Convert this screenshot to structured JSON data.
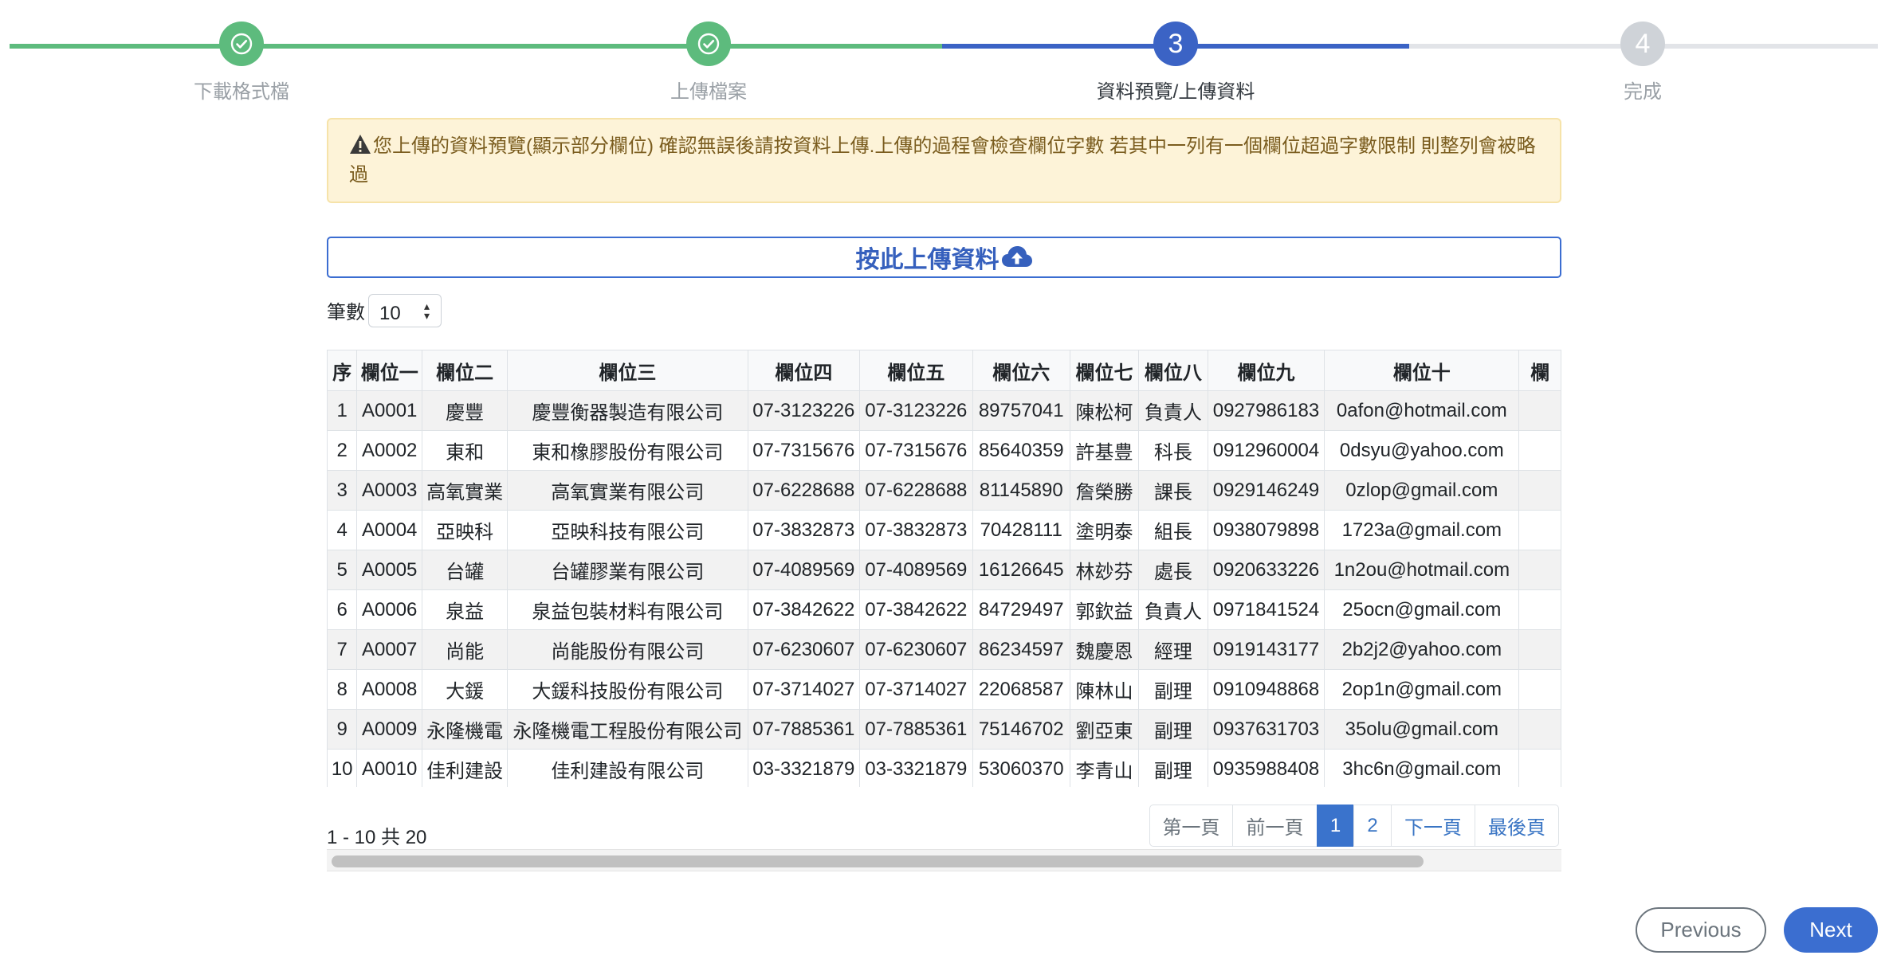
{
  "stepper": {
    "steps": [
      {
        "label": "下載格式檔",
        "state": "done"
      },
      {
        "label": "上傳檔案",
        "state": "done"
      },
      {
        "label": "資料預覽/上傳資料",
        "state": "active",
        "number": "3"
      },
      {
        "label": "完成",
        "state": "pending",
        "number": "4"
      }
    ],
    "colors": {
      "done": "#5dbb7d",
      "active": "#3b63c5",
      "pending": "#cfd3d8"
    }
  },
  "alert": {
    "icon": "warning-triangle-icon",
    "text": "您上傳的資料預覽(顯示部分欄位) 確認無誤後請按資料上傳.上傳的過程會檢查欄位字數 若其中一列有一個欄位超過字數限制 則整列會被略過"
  },
  "upload": {
    "label": "按此上傳資料",
    "icon": "cloud-upload-icon"
  },
  "page_size": {
    "label": "筆數",
    "value": "10"
  },
  "table": {
    "headers": [
      "序",
      "欄位一",
      "欄位二",
      "欄位三",
      "欄位四",
      "欄位五",
      "欄位六",
      "欄位七",
      "欄位八",
      "欄位九",
      "欄位十",
      "欄"
    ],
    "rows": [
      [
        "1",
        "A0001",
        "慶豐",
        "慶豐衡器製造有限公司",
        "07-3123226",
        "07-3123226",
        "89757041",
        "陳松柯",
        "負責人",
        "0927986183",
        "0afon@hotmail.com",
        ""
      ],
      [
        "2",
        "A0002",
        "東和",
        "東和橡膠股份有限公司",
        "07-7315676",
        "07-7315676",
        "85640359",
        "許基豊",
        "科長",
        "0912960004",
        "0dsyu@yahoo.com",
        ""
      ],
      [
        "3",
        "A0003",
        "高氧實業",
        "高氧實業有限公司",
        "07-6228688",
        "07-6228688",
        "81145890",
        "詹榮勝",
        "課長",
        "0929146249",
        "0zlop@gmail.com",
        ""
      ],
      [
        "4",
        "A0004",
        "亞映科",
        "亞映科技有限公司",
        "07-3832873",
        "07-3832873",
        "70428111",
        "塗明泰",
        "組長",
        "0938079898",
        "1723a@gmail.com",
        ""
      ],
      [
        "5",
        "A0005",
        "台罐",
        "台罐膠業有限公司",
        "07-4089569",
        "07-4089569",
        "16126645",
        "林玅芬",
        "處長",
        "0920633226",
        "1n2ou@hotmail.com",
        ""
      ],
      [
        "6",
        "A0006",
        "泉益",
        "泉益包裝材料有限公司",
        "07-3842622",
        "07-3842622",
        "84729497",
        "郭欽益",
        "負責人",
        "0971841524",
        "25ocn@gmail.com",
        ""
      ],
      [
        "7",
        "A0007",
        "尚能",
        "尚能股份有限公司",
        "07-6230607",
        "07-6230607",
        "86234597",
        "魏慶恩",
        "經理",
        "0919143177",
        "2b2j2@yahoo.com",
        ""
      ],
      [
        "8",
        "A0008",
        "大鍰",
        "大鍰科技股份有限公司",
        "07-3714027",
        "07-3714027",
        "22068587",
        "陳林山",
        "副理",
        "0910948868",
        "2op1n@gmail.com",
        ""
      ],
      [
        "9",
        "A0009",
        "永隆機電",
        "永隆機電工程股份有限公司",
        "07-7885361",
        "07-7885361",
        "75146702",
        "劉亞東",
        "副理",
        "0937631703",
        "35olu@gmail.com",
        ""
      ],
      [
        "10",
        "A0010",
        "佳利建設",
        "佳利建設有限公司",
        "03-3321879",
        "03-3321879",
        "53060370",
        "李青山",
        "副理",
        "0935988408",
        "3hc6n@gmail.com",
        ""
      ]
    ]
  },
  "pagination": {
    "summary": "1 - 10 共 20",
    "buttons": [
      {
        "label": "第一頁",
        "state": "disabled"
      },
      {
        "label": "前一頁",
        "state": "disabled"
      },
      {
        "label": "1",
        "state": "active"
      },
      {
        "label": "2",
        "state": "normal"
      },
      {
        "label": "下一頁",
        "state": "normal"
      },
      {
        "label": "最後頁",
        "state": "normal"
      }
    ]
  },
  "nav": {
    "previous": "Previous",
    "next": "Next"
  }
}
